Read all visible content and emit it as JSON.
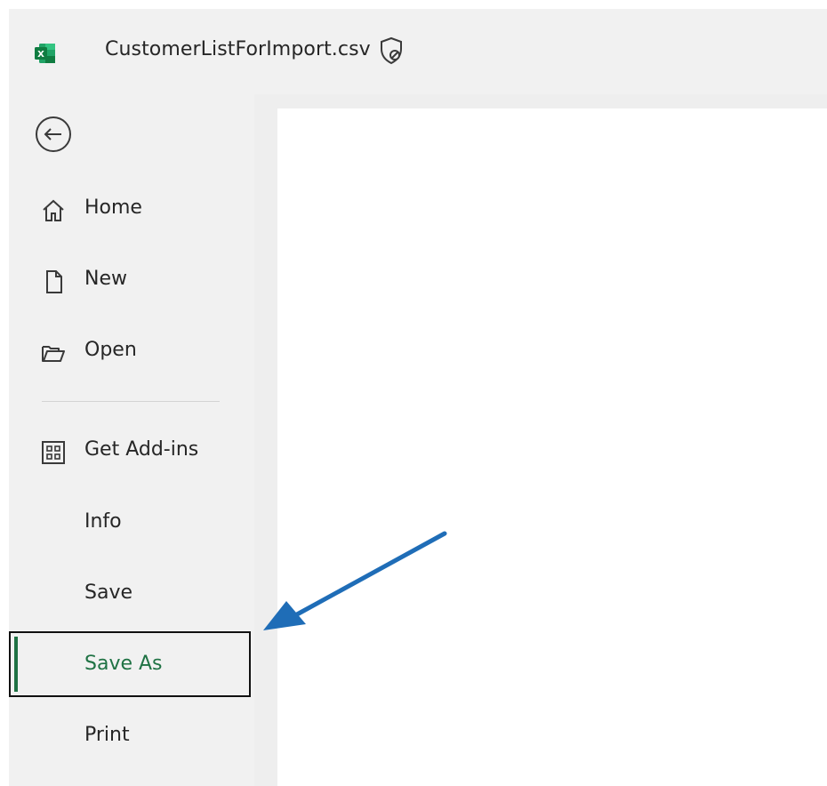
{
  "header": {
    "document_title": "CustomerListForImport.csv",
    "app_icon_text": "X"
  },
  "backstage": {
    "items": [
      {
        "id": "home",
        "label": "Home",
        "icon": "home-icon"
      },
      {
        "id": "new",
        "label": "New",
        "icon": "new-document-icon"
      },
      {
        "id": "open",
        "label": "Open",
        "icon": "open-folder-icon"
      },
      {
        "id": "get-add-ins",
        "label": "Get Add-ins",
        "icon": "add-ins-icon"
      },
      {
        "id": "info",
        "label": "Info"
      },
      {
        "id": "save",
        "label": "Save"
      },
      {
        "id": "save-as",
        "label": "Save As",
        "selected": true
      },
      {
        "id": "print",
        "label": "Print"
      }
    ]
  },
  "colors": {
    "excel_green": "#1f7244",
    "annotation_arrow": "#1f6db7"
  }
}
